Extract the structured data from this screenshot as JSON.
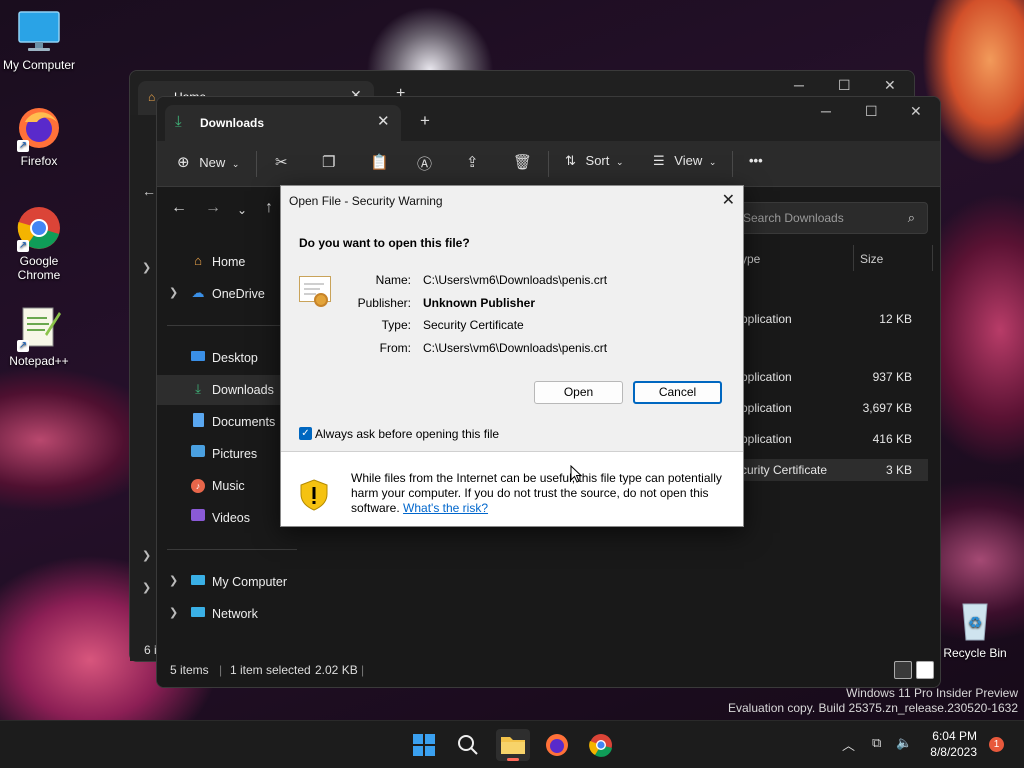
{
  "desktop": {
    "icons": [
      {
        "label": "My Computer"
      },
      {
        "label": "Firefox"
      },
      {
        "label": "Google Chrome"
      },
      {
        "label": "Notepad++"
      },
      {
        "label": "Recycle Bin"
      }
    ],
    "watermark_line1": "Windows 11 Pro Insider Preview",
    "watermark_line2": "Evaluation copy. Build 25375.zn_release.230520-1632"
  },
  "back_window": {
    "tab_title": "Home",
    "status_fragment": "6 i"
  },
  "explorer": {
    "tab_title": "Downloads",
    "toolbar": {
      "new_label": "New",
      "sort_label": "Sort",
      "view_label": "View",
      "more_label": "•••"
    },
    "search_placeholder": "Search Downloads",
    "sidebar": [
      {
        "label": "Home",
        "icon": "home-icon",
        "has_chevron": false
      },
      {
        "label": "OneDrive",
        "icon": "cloud-icon",
        "has_chevron": true
      },
      {
        "label": "Desktop",
        "icon": "desktop-icon",
        "has_chevron": false
      },
      {
        "label": "Downloads",
        "icon": "download-icon",
        "has_chevron": false,
        "selected": true
      },
      {
        "label": "Documents",
        "icon": "documents-icon",
        "has_chevron": false
      },
      {
        "label": "Pictures",
        "icon": "pictures-icon",
        "has_chevron": false
      },
      {
        "label": "Music",
        "icon": "music-icon",
        "has_chevron": false
      },
      {
        "label": "Videos",
        "icon": "videos-icon",
        "has_chevron": false
      },
      {
        "label": "My Computer",
        "icon": "computer-icon",
        "has_chevron": true
      },
      {
        "label": "Network",
        "icon": "network-icon",
        "has_chevron": true
      }
    ],
    "columns": {
      "type": "ype",
      "size": "Size"
    },
    "rows": [
      {
        "type": "Application",
        "size": "12 KB"
      },
      {
        "type": "Application",
        "size": "937 KB"
      },
      {
        "type": "Application",
        "size": "3,697 KB"
      },
      {
        "type": "Application",
        "size": "416 KB"
      },
      {
        "type": "Security Certificate",
        "size": "3 KB",
        "selected": true
      }
    ],
    "row_type_visible": [
      "pplication",
      "pplication",
      "pplication",
      "pplication",
      "curity Certificate"
    ],
    "status": {
      "items": "5 items",
      "selected": "1 item selected",
      "size": "2.02 KB"
    }
  },
  "dialog": {
    "title": "Open File - Security Warning",
    "question": "Do you want to open this file?",
    "fields": [
      {
        "key": "Name:",
        "value": "C:\\Users\\vm6\\Downloads\\penis.crt",
        "bold": false
      },
      {
        "key": "Publisher:",
        "value": "Unknown Publisher",
        "bold": true
      },
      {
        "key": "Type:",
        "value": "Security Certificate",
        "bold": false
      },
      {
        "key": "From:",
        "value": "C:\\Users\\vm6\\Downloads\\penis.crt",
        "bold": false
      }
    ],
    "open_label": "Open",
    "cancel_label": "Cancel",
    "checkbox_label": "Always ask before opening this file",
    "checkbox_checked": true,
    "warning_text": "While files from the Internet can be useful, this file type can potentially harm your computer. If you do not trust the source, do not open this software.",
    "risk_link": "What's the risk?",
    "accent_color": "#0067c0"
  },
  "taskbar": {
    "time": "6:04 PM",
    "date": "8/8/2023",
    "notification_count": "1"
  }
}
